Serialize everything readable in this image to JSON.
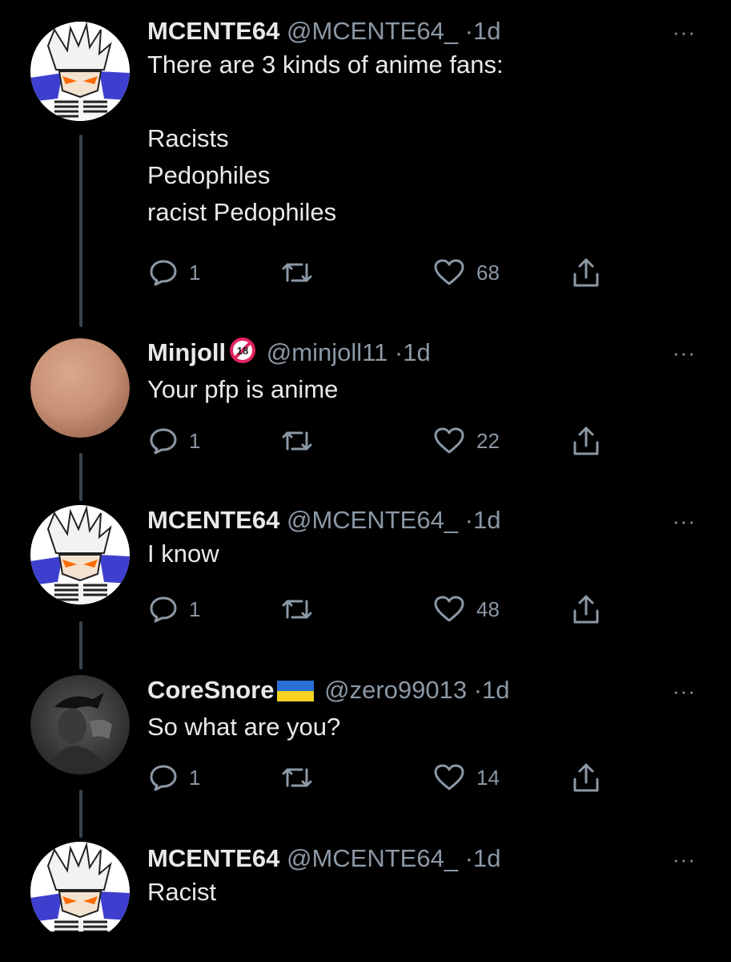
{
  "tweets": [
    {
      "name": "MCENTE64",
      "handle": "@MCENTE64_",
      "dot": "·",
      "time": "1d",
      "lines": [
        "There are 3 kinds of anime fans:",
        "",
        "Racists",
        "Pedophiles",
        "racist Pedophiles"
      ],
      "reply_count": "1",
      "retweet_count": "",
      "like_count": "68",
      "avatar": "vegeta-anime-avatar"
    },
    {
      "name": "Minjoll",
      "badge": "18",
      "handle": "@minjoll11",
      "dot": "·",
      "time": "1d",
      "lines": [
        "Your pfp is anime"
      ],
      "reply_count": "1",
      "retweet_count": "",
      "like_count": "22",
      "avatar": "skin-tone-circle-avatar"
    },
    {
      "name": "MCENTE64",
      "handle": "@MCENTE64_",
      "dot": "·",
      "time": "1d",
      "lines": [
        "I know"
      ],
      "reply_count": "1",
      "retweet_count": "",
      "like_count": "48",
      "avatar": "vegeta-anime-avatar"
    },
    {
      "name": "CoreSnore",
      "flag": "ukraine-flag",
      "handle": "@zero99013",
      "dot": "·",
      "time": "1d",
      "lines": [
        "So what are you?"
      ],
      "reply_count": "1",
      "retweet_count": "",
      "like_count": "14",
      "avatar": "grayscale-figure-avatar"
    },
    {
      "name": "MCENTE64",
      "handle": "@MCENTE64_",
      "dot": "·",
      "time": "1d",
      "lines": [
        "Racist"
      ],
      "avatar": "vegeta-anime-avatar"
    }
  ],
  "more_label": "···",
  "colors": {
    "background": "#000000",
    "primary_text": "#e7e9ea",
    "secondary_text": "#8b98a5",
    "thread_line": "#38444d",
    "avatar_blue": "#3f3fcf",
    "badge_red": "#e0245e",
    "flag_blue": "#2a6fd6",
    "flag_yellow": "#f4d21e"
  }
}
